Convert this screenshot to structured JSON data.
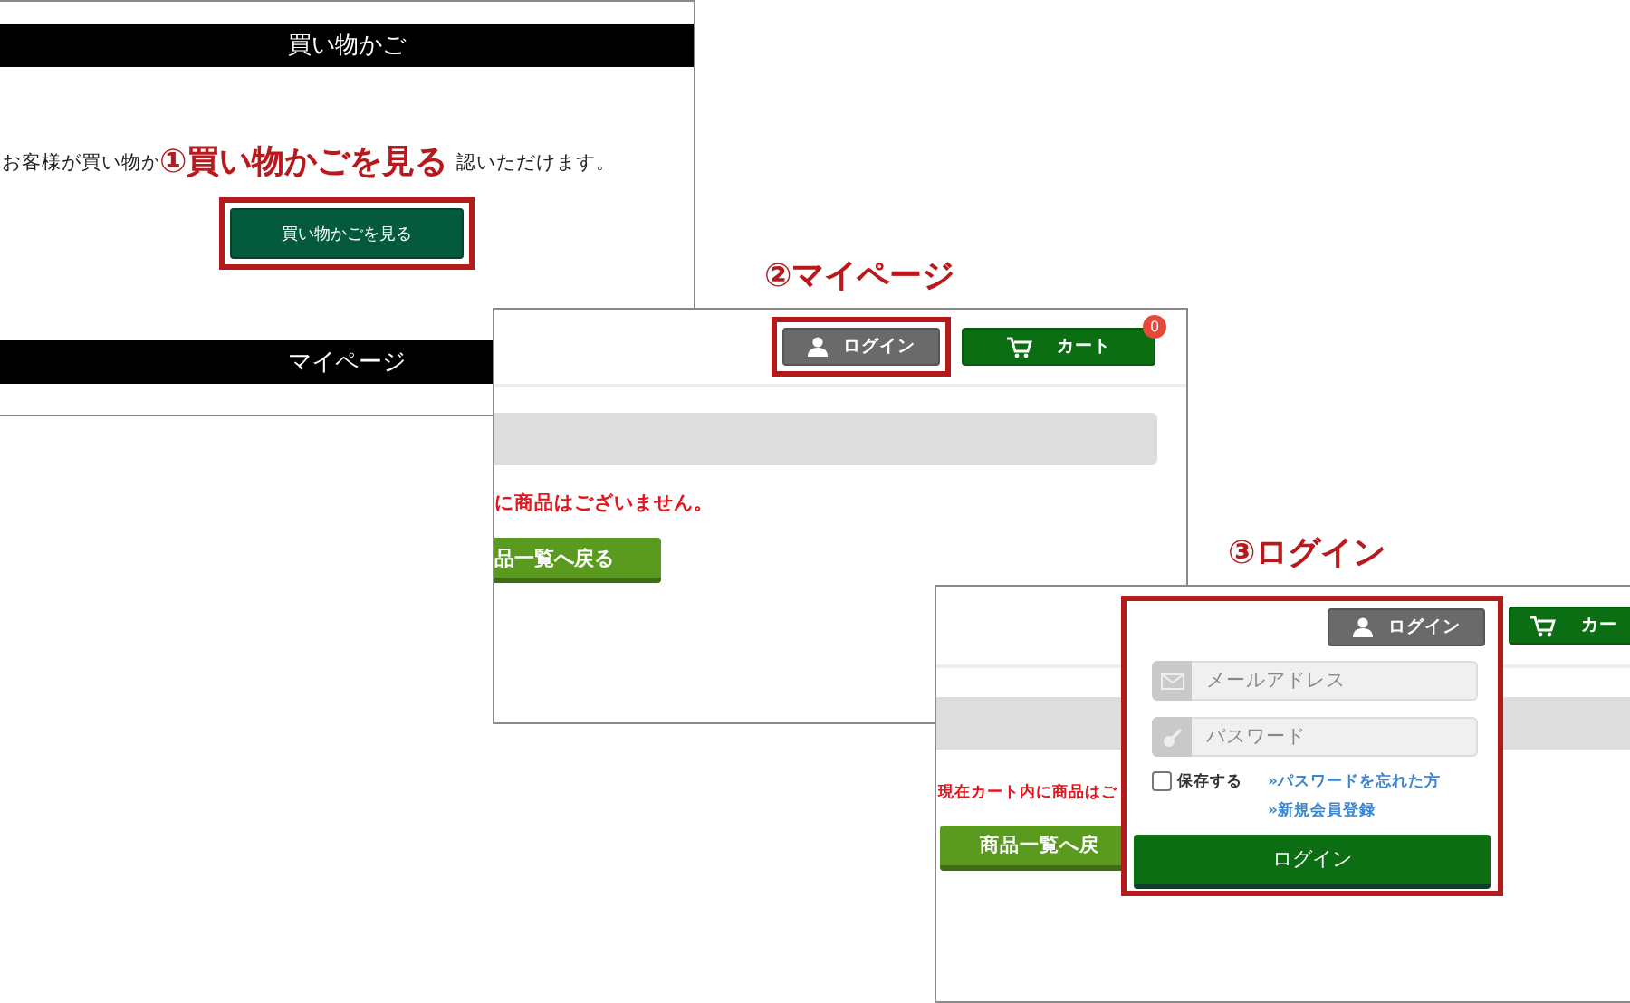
{
  "cart_page": {
    "header": "買い物かご",
    "text_before": "お客様が買い物か",
    "text_after": "認いただけます。",
    "button": "買い物かごを見る",
    "next_header": "マイページ"
  },
  "mypage": {
    "login_button": "ログイン",
    "cart_button": "カート",
    "cart_count": "0",
    "empty_message": "に商品はございません。",
    "back_button": "品一覧へ戻る"
  },
  "login_page": {
    "cart_button": "カー",
    "empty_message": "現在カート内に商品はご",
    "back_button": "商品一覧へ戻",
    "login_form": {
      "login_button": "ログイン",
      "email_placeholder": "メールアドレス",
      "password_placeholder": "パスワード",
      "remember": {
        "label": "保存する",
        "checked": false
      },
      "links": [
        "»パスワードを忘れた方",
        "»新規会員登録"
      ],
      "submit": "ログイン"
    }
  },
  "callouts": [
    {
      "label": "①買い物かごを見る"
    },
    {
      "label": "②マイページ"
    },
    {
      "label": "③ログイン"
    }
  ]
}
